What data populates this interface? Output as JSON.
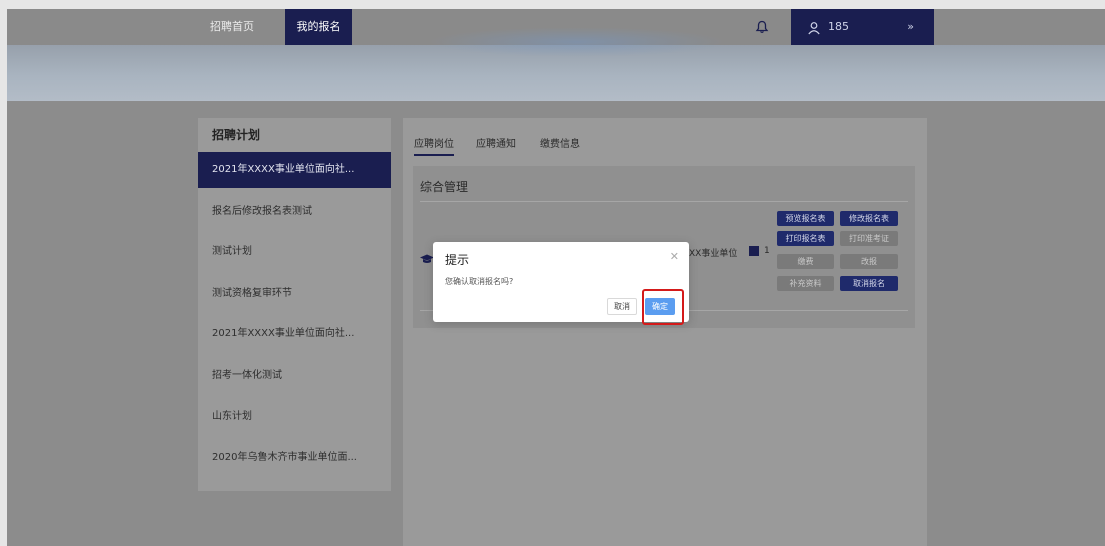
{
  "nav": {
    "home_label": "招聘首页",
    "my_signup_label": "我的报名",
    "username": "185",
    "bell_icon": "bell-icon",
    "user_icon": "user-icon",
    "chevron_icon": "double-chevron-down-icon",
    "accent_color": "#1a1e50"
  },
  "sidebar": {
    "title": "招聘计划",
    "items": [
      {
        "label": "2021年XXXX事业单位面向社...",
        "active": true
      },
      {
        "label": "报名后修改报名表测试",
        "active": false
      },
      {
        "label": "测试计划",
        "active": false
      },
      {
        "label": "测试资格复审环节",
        "active": false
      },
      {
        "label": "2021年XXXX事业单位面向社...",
        "active": false
      },
      {
        "label": "招考一体化测试",
        "active": false
      },
      {
        "label": "山东计划",
        "active": false
      },
      {
        "label": "2020年乌鲁木齐市事业单位面...",
        "active": false
      }
    ]
  },
  "tabs": [
    {
      "label": "应聘岗位",
      "active": true
    },
    {
      "label": "应聘通知",
      "active": false
    },
    {
      "label": "缴费信息",
      "active": false
    }
  ],
  "section": {
    "title": "综合管理",
    "job_unit": "XX事业单位",
    "job_count": "1",
    "buttons": {
      "preview": "预览报名表",
      "edit": "修改报名表",
      "print_form": "打印报名表",
      "print_ticket": "打印准考证",
      "pay": "缴费",
      "change": "改报",
      "supplement": "补充资料",
      "cancel_signup": "取消报名"
    }
  },
  "dialog": {
    "title": "提示",
    "message": "您确认取消报名吗?",
    "cancel_label": "取消",
    "ok_label": "确定",
    "close_icon": "close-icon",
    "ok_color": "#5b9df0",
    "highlight_color": "#d41a1a"
  }
}
